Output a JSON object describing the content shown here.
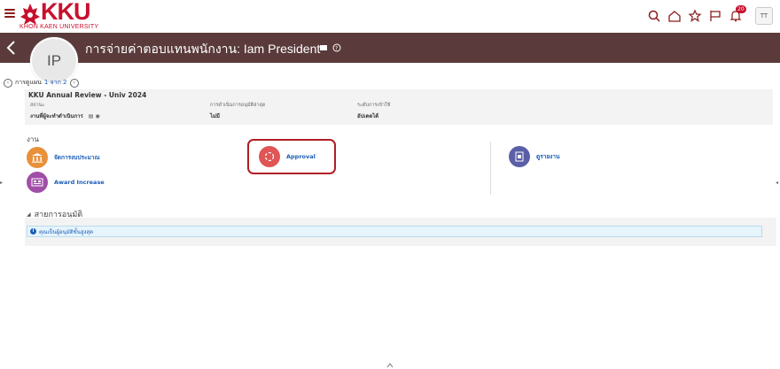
{
  "header": {
    "logo_text": "KKU",
    "logo_sub": "KHON KAEN UNIVERSITY",
    "notification_count": "20",
    "user_initials": "TT",
    "icons": [
      "search-icon",
      "home-icon",
      "star-icon",
      "flag-icon",
      "bell-icon"
    ]
  },
  "banner": {
    "avatar_initials": "IP",
    "title": "การจ่ายค่าตอบแทนพนักงาน: Iam President"
  },
  "pager": {
    "label": "การดูแผน",
    "current": "1 จาก 2"
  },
  "review": {
    "title": "KKU Annual Review - Univ 2024",
    "fields": [
      {
        "label": "สถานะ",
        "value": "งานที่ผู้จะทำดำเนินการ"
      },
      {
        "label": "การดำเนินการอนุมัติล่าสุด",
        "value": "ไม่มี"
      },
      {
        "label": "ระดับการเข้าใช้",
        "value": "อัปเดตได้"
      }
    ]
  },
  "tasks": {
    "label": "งาน",
    "items": [
      {
        "label": "จัดการงบประมาณ",
        "color": "#e8903a",
        "icon": "bank-icon"
      },
      {
        "label": "Award Increase",
        "color": "#a04fa8",
        "icon": "award-icon"
      },
      {
        "label": "Approval",
        "color": "#e05555",
        "icon": "approval-icon"
      },
      {
        "label": "ดูรายงาน",
        "color": "#5a5fa8",
        "icon": "report-icon"
      }
    ]
  },
  "approvals": {
    "title": "สายการอนุมัติ",
    "info": "คุณเป็นผู้อนุมัติขั้นสูงสุด"
  },
  "colors": {
    "brand": "#c8102e",
    "banner": "#5a3a3a",
    "highlight": "#b01e24",
    "link": "#1a5eb8"
  }
}
